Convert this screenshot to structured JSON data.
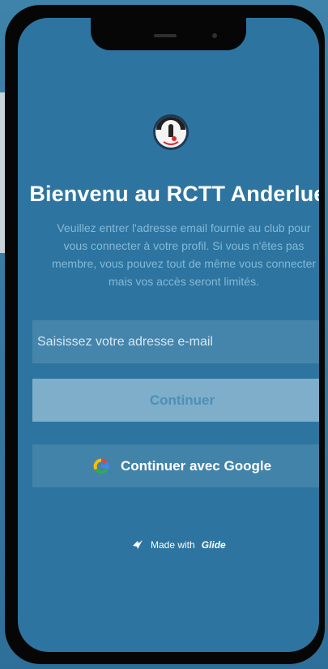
{
  "login": {
    "title": "Bienvenu au RCTT Anderlues",
    "subtitle_lines": [
      "Veuillez entrer l'adresse email fournie au club pour",
      "vous connecter à votre profil. Si vous n'êtes pas",
      "membre, vous pouvez tout de même vous connecter",
      "mais vos accès seront limités."
    ],
    "email_placeholder": "Saisissez votre adresse e-mail",
    "continue_label": "Continuer",
    "google_label": "Continuer avec Google"
  },
  "footer": {
    "made_with": "Made with",
    "brand": "Glide"
  },
  "icons": {
    "logo": "club-logo-icon",
    "google": "google-icon",
    "glide": "glide-icon"
  },
  "colors": {
    "background": "#2d75a0",
    "continue_button_bg": "#7eaec9",
    "continue_button_text": "#4d8fb7",
    "subtitle_text": "#85b8d7",
    "text": "#ffffff"
  }
}
